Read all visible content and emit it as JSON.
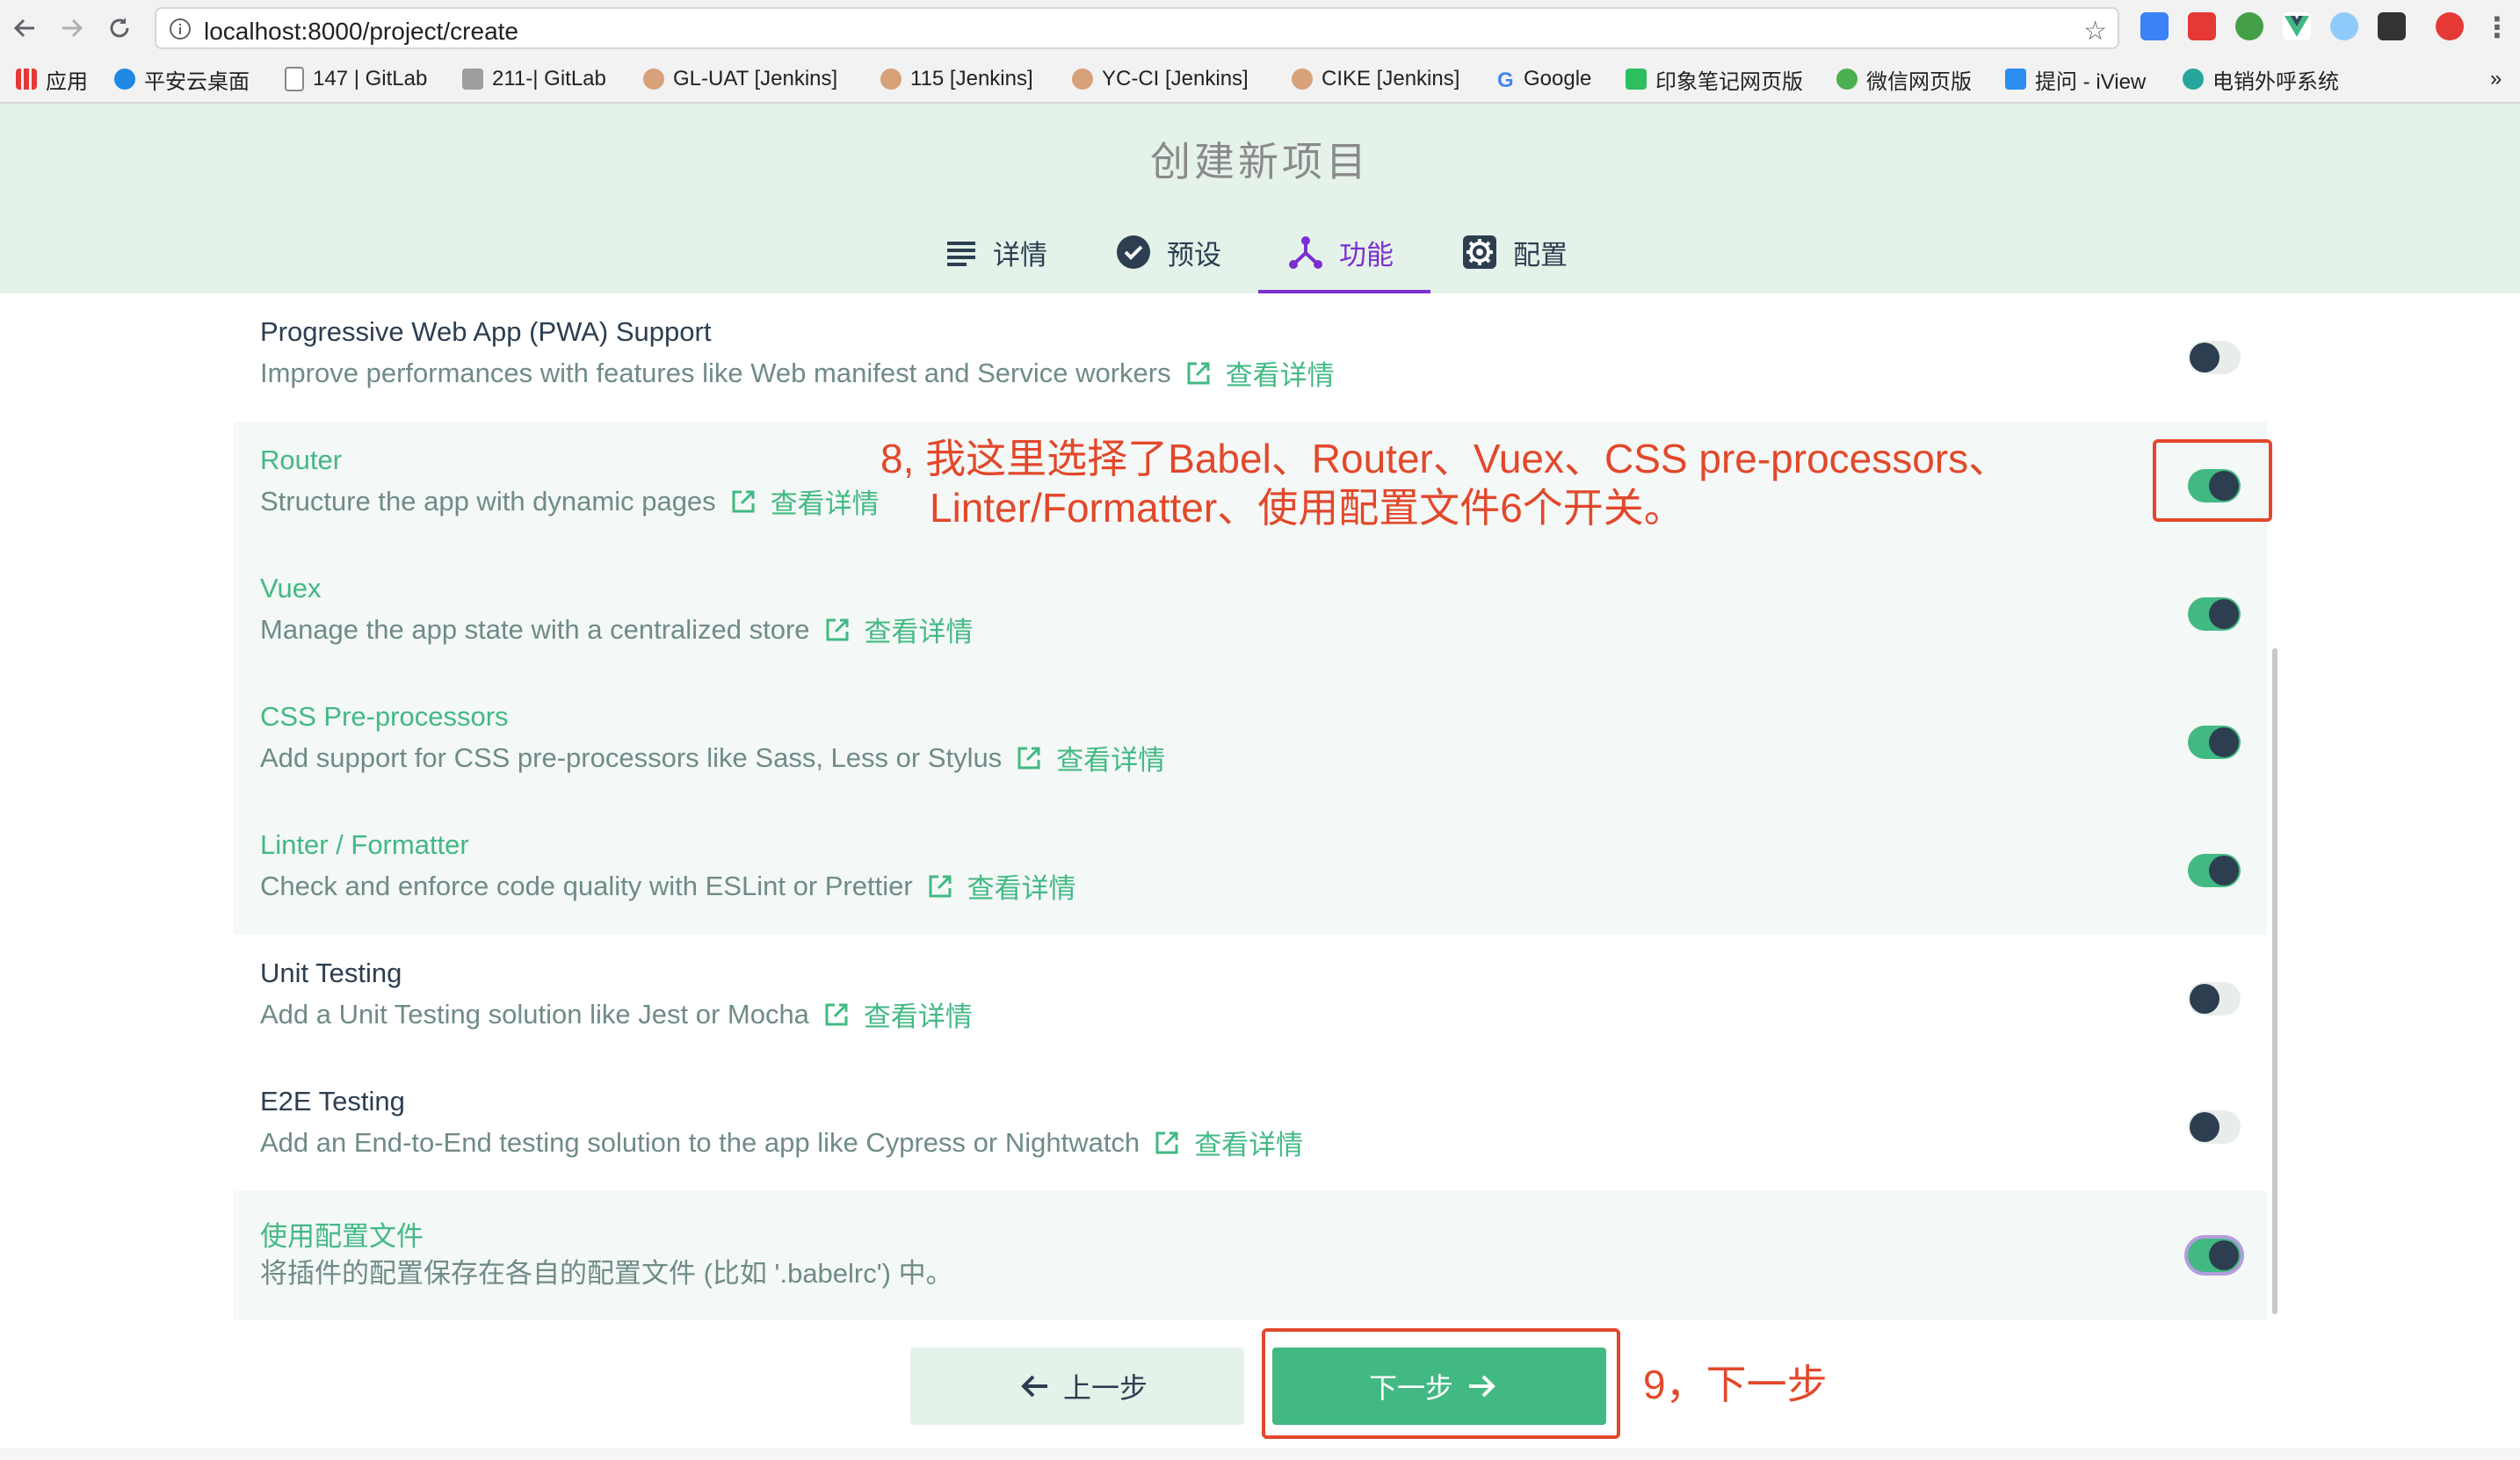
{
  "browser": {
    "url": "localhost:8000/project/create",
    "bookmarks": [
      {
        "label": "应用",
        "icon": "apps-grid-icon"
      },
      {
        "label": "平安云桌面",
        "icon": "cloud-icon"
      },
      {
        "label": "147 | GitLab",
        "icon": "page-icon"
      },
      {
        "label": "211-| GitLab",
        "icon": "gitlab-icon"
      },
      {
        "label": "GL-UAT [Jenkins]",
        "icon": "jenkins-icon"
      },
      {
        "label": "115 [Jenkins]",
        "icon": "jenkins-icon"
      },
      {
        "label": "YC-CI [Jenkins]",
        "icon": "jenkins-icon"
      },
      {
        "label": "CIKE [Jenkins]",
        "icon": "jenkins-icon"
      },
      {
        "label": "Google",
        "icon": "google-icon"
      },
      {
        "label": "印象笔记网页版",
        "icon": "evernote-icon"
      },
      {
        "label": "微信网页版",
        "icon": "wechat-icon"
      },
      {
        "label": "提问 - iView",
        "icon": "iview-icon"
      },
      {
        "label": "电销外呼系统",
        "icon": "phone-system-icon"
      }
    ],
    "overflow": "»"
  },
  "header": {
    "title": "创建新项目",
    "tabs": [
      {
        "label": "详情",
        "icon": "list-icon",
        "active": false
      },
      {
        "label": "预设",
        "icon": "check-circle-icon",
        "active": false
      },
      {
        "label": "功能",
        "icon": "feature-tree-icon",
        "active": true
      },
      {
        "label": "配置",
        "icon": "gear-icon",
        "active": false
      }
    ]
  },
  "features": {
    "more_label": "查看详情",
    "items": [
      {
        "name": "Progressive Web App (PWA) Support",
        "desc": "Improve performances with features like Web manifest and Service workers",
        "enabled": false,
        "link": true
      },
      {
        "name": "Router",
        "desc": "Structure the app with dynamic pages",
        "enabled": true,
        "link": true
      },
      {
        "name": "Vuex",
        "desc": "Manage the app state with a centralized store",
        "enabled": true,
        "link": true
      },
      {
        "name": "CSS Pre-processors",
        "desc": "Add support for CSS pre-processors like Sass, Less or Stylus",
        "enabled": true,
        "link": true
      },
      {
        "name": "Linter / Formatter",
        "desc": "Check and enforce code quality with ESLint or Prettier",
        "enabled": true,
        "link": true
      },
      {
        "name": "Unit Testing",
        "desc": "Add a Unit Testing solution like Jest or Mocha",
        "enabled": false,
        "link": true
      },
      {
        "name": "E2E Testing",
        "desc": "Add an End-to-End testing solution to the app like Cypress or Nightwatch",
        "enabled": false,
        "link": true
      },
      {
        "name": "使用配置文件",
        "desc": "将插件的配置保存在各自的配置文件 (比如 '.babelrc') 中。",
        "enabled": true,
        "link": false
      }
    ]
  },
  "footer": {
    "prev_label": "上一步",
    "next_label": "下一步"
  },
  "annotations": {
    "note8_line1": "8, 我这里选择了Babel、Router、Vuex、CSS pre-processors、",
    "note8_line2": "Linter/Formatter、使用配置文件6个开关。",
    "note9": "9，下一步"
  },
  "colors": {
    "accent": "#42b983",
    "tab_active": "#7b2fd0",
    "annotation": "#e2482b",
    "header_bg": "#e4f2ea"
  }
}
